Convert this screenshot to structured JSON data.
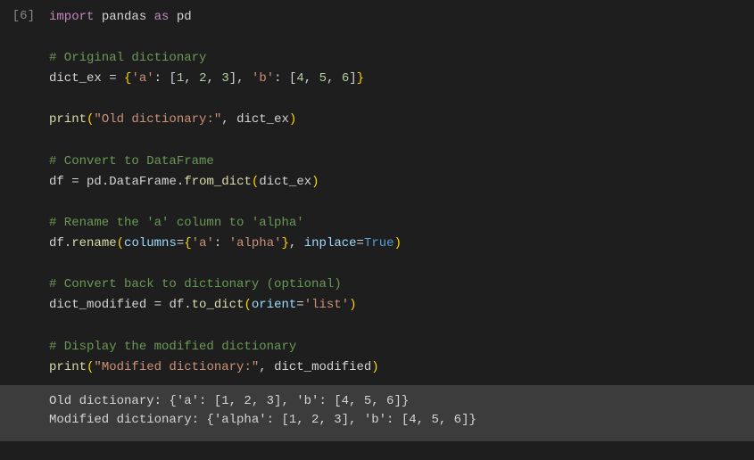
{
  "cell": {
    "prompt": "[6]",
    "lines": {
      "l1_import": "import",
      "l1_pandas": " pandas ",
      "l1_as": "as",
      "l1_pd": " pd",
      "l3_comment": "# Original dictionary",
      "l4_var": "dict_ex ",
      "l4_eq": "= ",
      "l4_brace_o": "{",
      "l4_key_a": "'a'",
      "l4_colon1": ": ",
      "l4_brack_o1": "[",
      "l4_n1": "1",
      "l4_c1": ", ",
      "l4_n2": "2",
      "l4_c2": ", ",
      "l4_n3": "3",
      "l4_brack_c1": "]",
      "l4_c3": ", ",
      "l4_key_b": "'b'",
      "l4_colon2": ": ",
      "l4_brack_o2": "[",
      "l4_n4": "4",
      "l4_c4": ", ",
      "l4_n5": "5",
      "l4_c5": ", ",
      "l4_n6": "6",
      "l4_brack_c2": "]",
      "l4_brace_c": "}",
      "l6_print": "print",
      "l6_paren_o": "(",
      "l6_str": "\"Old dictionary:\"",
      "l6_c": ", ",
      "l6_var": "dict_ex",
      "l6_paren_c": ")",
      "l8_comment": "# Convert to DataFrame",
      "l9_var": "df ",
      "l9_eq": "= ",
      "l9_pd": "pd",
      "l9_dot1": ".",
      "l9_df": "DataFrame",
      "l9_dot2": ".",
      "l9_from": "from_dict",
      "l9_paren_o": "(",
      "l9_arg": "dict_ex",
      "l9_paren_c": ")",
      "l11_comment": "# Rename the 'a' column to 'alpha'",
      "l12_var": "df",
      "l12_dot": ".",
      "l12_rename": "rename",
      "l12_paren_o": "(",
      "l12_cols": "columns",
      "l12_eq": "=",
      "l12_brace_o": "{",
      "l12_k": "'a'",
      "l12_colon": ": ",
      "l12_v": "'alpha'",
      "l12_brace_c": "}",
      "l12_c": ", ",
      "l12_inplace": "inplace",
      "l12_eq2": "=",
      "l12_true": "True",
      "l12_paren_c": ")",
      "l14_comment": "# Convert back to dictionary (optional)",
      "l15_var": "dict_modified ",
      "l15_eq": "= ",
      "l15_df": "df",
      "l15_dot": ".",
      "l15_todict": "to_dict",
      "l15_paren_o": "(",
      "l15_orient": "orient",
      "l15_eq2": "=",
      "l15_list": "'list'",
      "l15_paren_c": ")",
      "l17_comment": "# Display the modified dictionary",
      "l18_print": "print",
      "l18_paren_o": "(",
      "l18_str": "\"Modified dictionary:\"",
      "l18_c": ", ",
      "l18_var": "dict_modified",
      "l18_paren_c": ")"
    }
  },
  "output": {
    "line1": "Old dictionary: {'a': [1, 2, 3], 'b': [4, 5, 6]}",
    "line2": "Modified dictionary: {'alpha': [1, 2, 3], 'b': [4, 5, 6]}"
  }
}
